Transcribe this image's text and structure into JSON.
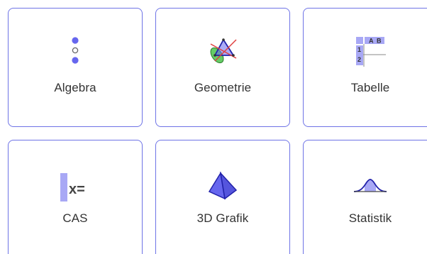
{
  "apps": [
    {
      "id": "algebra",
      "label": "Algebra",
      "icon": "algebra-icon"
    },
    {
      "id": "geometrie",
      "label": "Geometrie",
      "icon": "geometry-icon"
    },
    {
      "id": "tabelle",
      "label": "Tabelle",
      "icon": "spreadsheet-icon"
    },
    {
      "id": "cas",
      "label": "CAS",
      "icon": "cas-icon"
    },
    {
      "id": "3d",
      "label": "3D Grafik",
      "icon": "3d-graphics-icon"
    },
    {
      "id": "statistik",
      "label": "Statistik",
      "icon": "statistics-icon"
    }
  ],
  "icon_text": {
    "spreadsheet_col_a": "A",
    "spreadsheet_col_b": "B",
    "spreadsheet_row_1": "1",
    "spreadsheet_row_2": "2",
    "cas_symbol": "x="
  },
  "colors": {
    "accent": "#6e73e6",
    "icon_fill": "#6666ee",
    "icon_light": "#a8a8f5",
    "geometry_green": "#66cc66",
    "geometry_red": "#e04040",
    "label_text": "#333333"
  }
}
